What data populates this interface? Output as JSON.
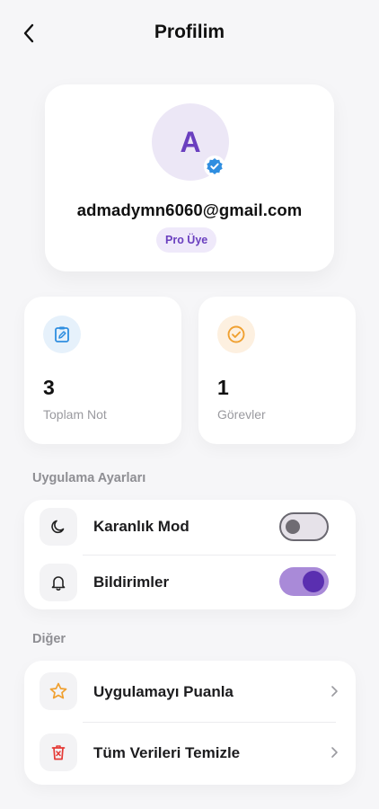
{
  "header": {
    "title": "Profilim",
    "back_icon": "chevron-left-icon"
  },
  "profile": {
    "avatar_letter": "A",
    "email": "admadymn6060@gmail.com",
    "badge": "Pro Üye",
    "verified_icon": "verified-check-icon",
    "accent_color": "#6a3fbf"
  },
  "stats": [
    {
      "value": "3",
      "label": "Toplam Not",
      "icon": "note-edit-icon",
      "color": "#2f8ee0"
    },
    {
      "value": "1",
      "label": "Görevler",
      "icon": "check-circle-icon",
      "color": "#f0a030"
    }
  ],
  "app_settings": {
    "title": "Uygulama Ayarları",
    "items": [
      {
        "label": "Karanlık Mod",
        "icon": "moon-icon",
        "enabled": false
      },
      {
        "label": "Bildirimler",
        "icon": "bell-icon",
        "enabled": true
      }
    ]
  },
  "other": {
    "title": "Diğer",
    "items": [
      {
        "label": "Uygulamayı Puanla",
        "icon": "star-icon",
        "color": "#f0a030"
      },
      {
        "label": "Tüm Verileri Temizle",
        "icon": "trash-icon",
        "color": "#e53935"
      }
    ]
  }
}
